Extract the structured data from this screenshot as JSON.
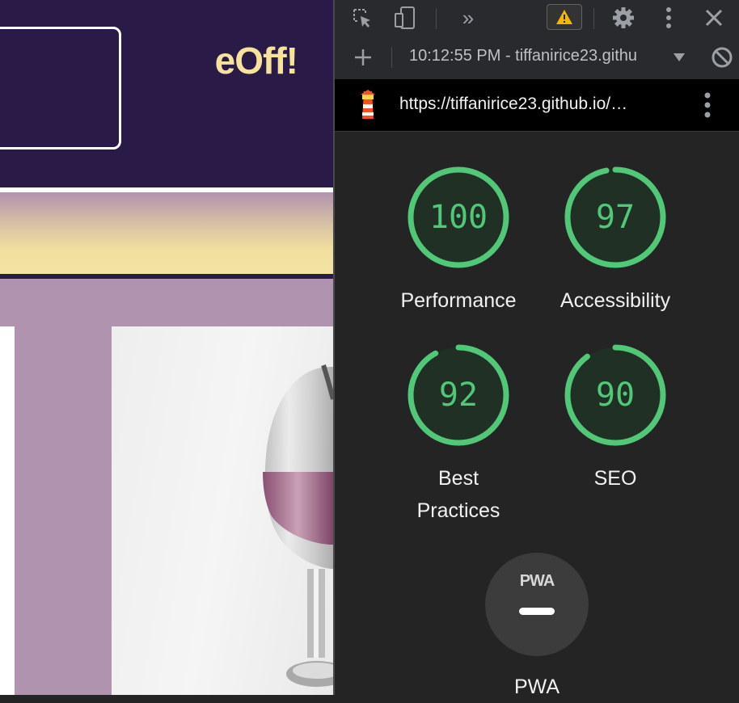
{
  "page": {
    "header_button_text": "eOff!"
  },
  "devtools": {
    "toolbar": {
      "more_tabs": "»"
    },
    "report_selector": "10:12:55 PM - tiffanirice23.githu",
    "report_url": "https://tiffanirice23.github.io/…",
    "scores": [
      {
        "label": "Performance",
        "value": "100",
        "score": 100
      },
      {
        "label": "Accessibility",
        "value": "97",
        "score": 97
      },
      {
        "label": "Best Practices",
        "value": "92",
        "score": 92
      },
      {
        "label": "SEO",
        "value": "90",
        "score": 90
      }
    ],
    "pwa": {
      "logo": "PWA",
      "label": "PWA"
    },
    "colors": {
      "pass": "#50c878",
      "pass_track": "#1e3b26",
      "panel_bg": "#242424",
      "page_header": "#2a1a47",
      "page_accent": "#f6e29a",
      "page_bg": "#b093ae"
    }
  }
}
